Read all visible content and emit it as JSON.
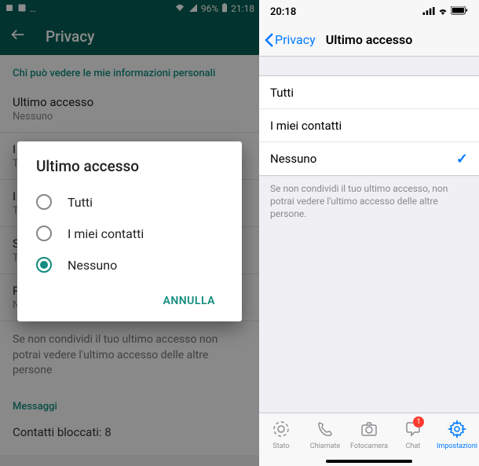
{
  "android": {
    "status": {
      "battery_pct": "96%",
      "time": "21:18"
    },
    "appbar": {
      "title": "Privacy"
    },
    "section_header": "Chi può vedere le mie informazioni personali",
    "rows": [
      {
        "title": "Ultimo accesso",
        "sub": "Nessuno"
      },
      {
        "title": "I",
        "sub": "T"
      },
      {
        "title": "I",
        "sub": "T"
      },
      {
        "title": "S",
        "sub": "T"
      },
      {
        "title": "P",
        "sub": "N"
      }
    ],
    "note": "Se non condividi il tuo ultimo accesso non potrai vedere l'ultimo accesso delle altre persone",
    "messages_header": "Messaggi",
    "blocked": "Contatti bloccati: 8",
    "dialog": {
      "title": "Ultimo accesso",
      "options": [
        "Tutti",
        "I miei contatti",
        "Nessuno"
      ],
      "selected_index": 2,
      "cancel": "ANNULLA"
    }
  },
  "ios": {
    "status": {
      "time": "20:18"
    },
    "nav": {
      "back": "Privacy",
      "title": "Ultimo accesso"
    },
    "options": [
      {
        "label": "Tutti",
        "selected": false
      },
      {
        "label": "I miei contatti",
        "selected": false
      },
      {
        "label": "Nessuno",
        "selected": true
      }
    ],
    "footer_note": "Se non condividi il tuo ultimo accesso, non potrai vedere l'ultimo accesso delle altre persone.",
    "tabs": [
      {
        "label": "Stato",
        "icon": "status-icon"
      },
      {
        "label": "Chiamate",
        "icon": "phone-icon"
      },
      {
        "label": "Fotocamera",
        "icon": "camera-icon"
      },
      {
        "label": "Chat",
        "icon": "chat-icon",
        "badge": "1"
      },
      {
        "label": "Impostazioni",
        "icon": "gear-icon",
        "active": true
      }
    ]
  }
}
